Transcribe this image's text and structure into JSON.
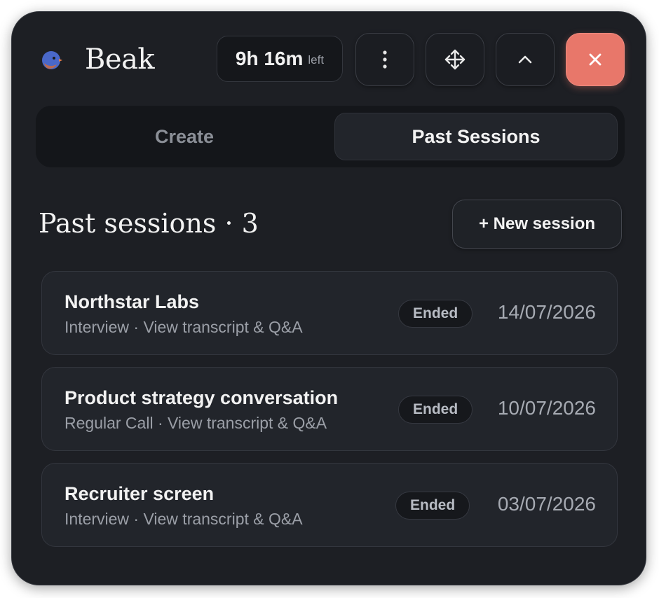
{
  "app": {
    "title": "Beak",
    "timer_value": "9h 16m",
    "timer_suffix": "left",
    "icons": {
      "logo": "bird-logo-icon",
      "more": "more-vertical-icon",
      "move": "move-arrows-icon",
      "collapse": "chevron-up-icon",
      "close": "close-icon"
    },
    "colors": {
      "background": "#1d1f24",
      "close_button": "#e8776a",
      "logo_blue": "#4a68c9",
      "logo_orange": "#e57b46"
    }
  },
  "tabs": [
    {
      "label": "Create",
      "active": false
    },
    {
      "label": "Past Sessions",
      "active": true
    }
  ],
  "section": {
    "title": "Past sessions · 3",
    "new_session_label": "+ New session"
  },
  "sessions": [
    {
      "name": "Northstar Labs",
      "meta": "Interview · View transcript & Q&A",
      "status": "Ended",
      "date": "14/07/2026"
    },
    {
      "name": "Product strategy conversation",
      "meta": "Regular Call · View transcript & Q&A",
      "status": "Ended",
      "date": "10/07/2026"
    },
    {
      "name": "Recruiter screen",
      "meta": "Interview · View transcript & Q&A",
      "status": "Ended",
      "date": "03/07/2026"
    }
  ]
}
